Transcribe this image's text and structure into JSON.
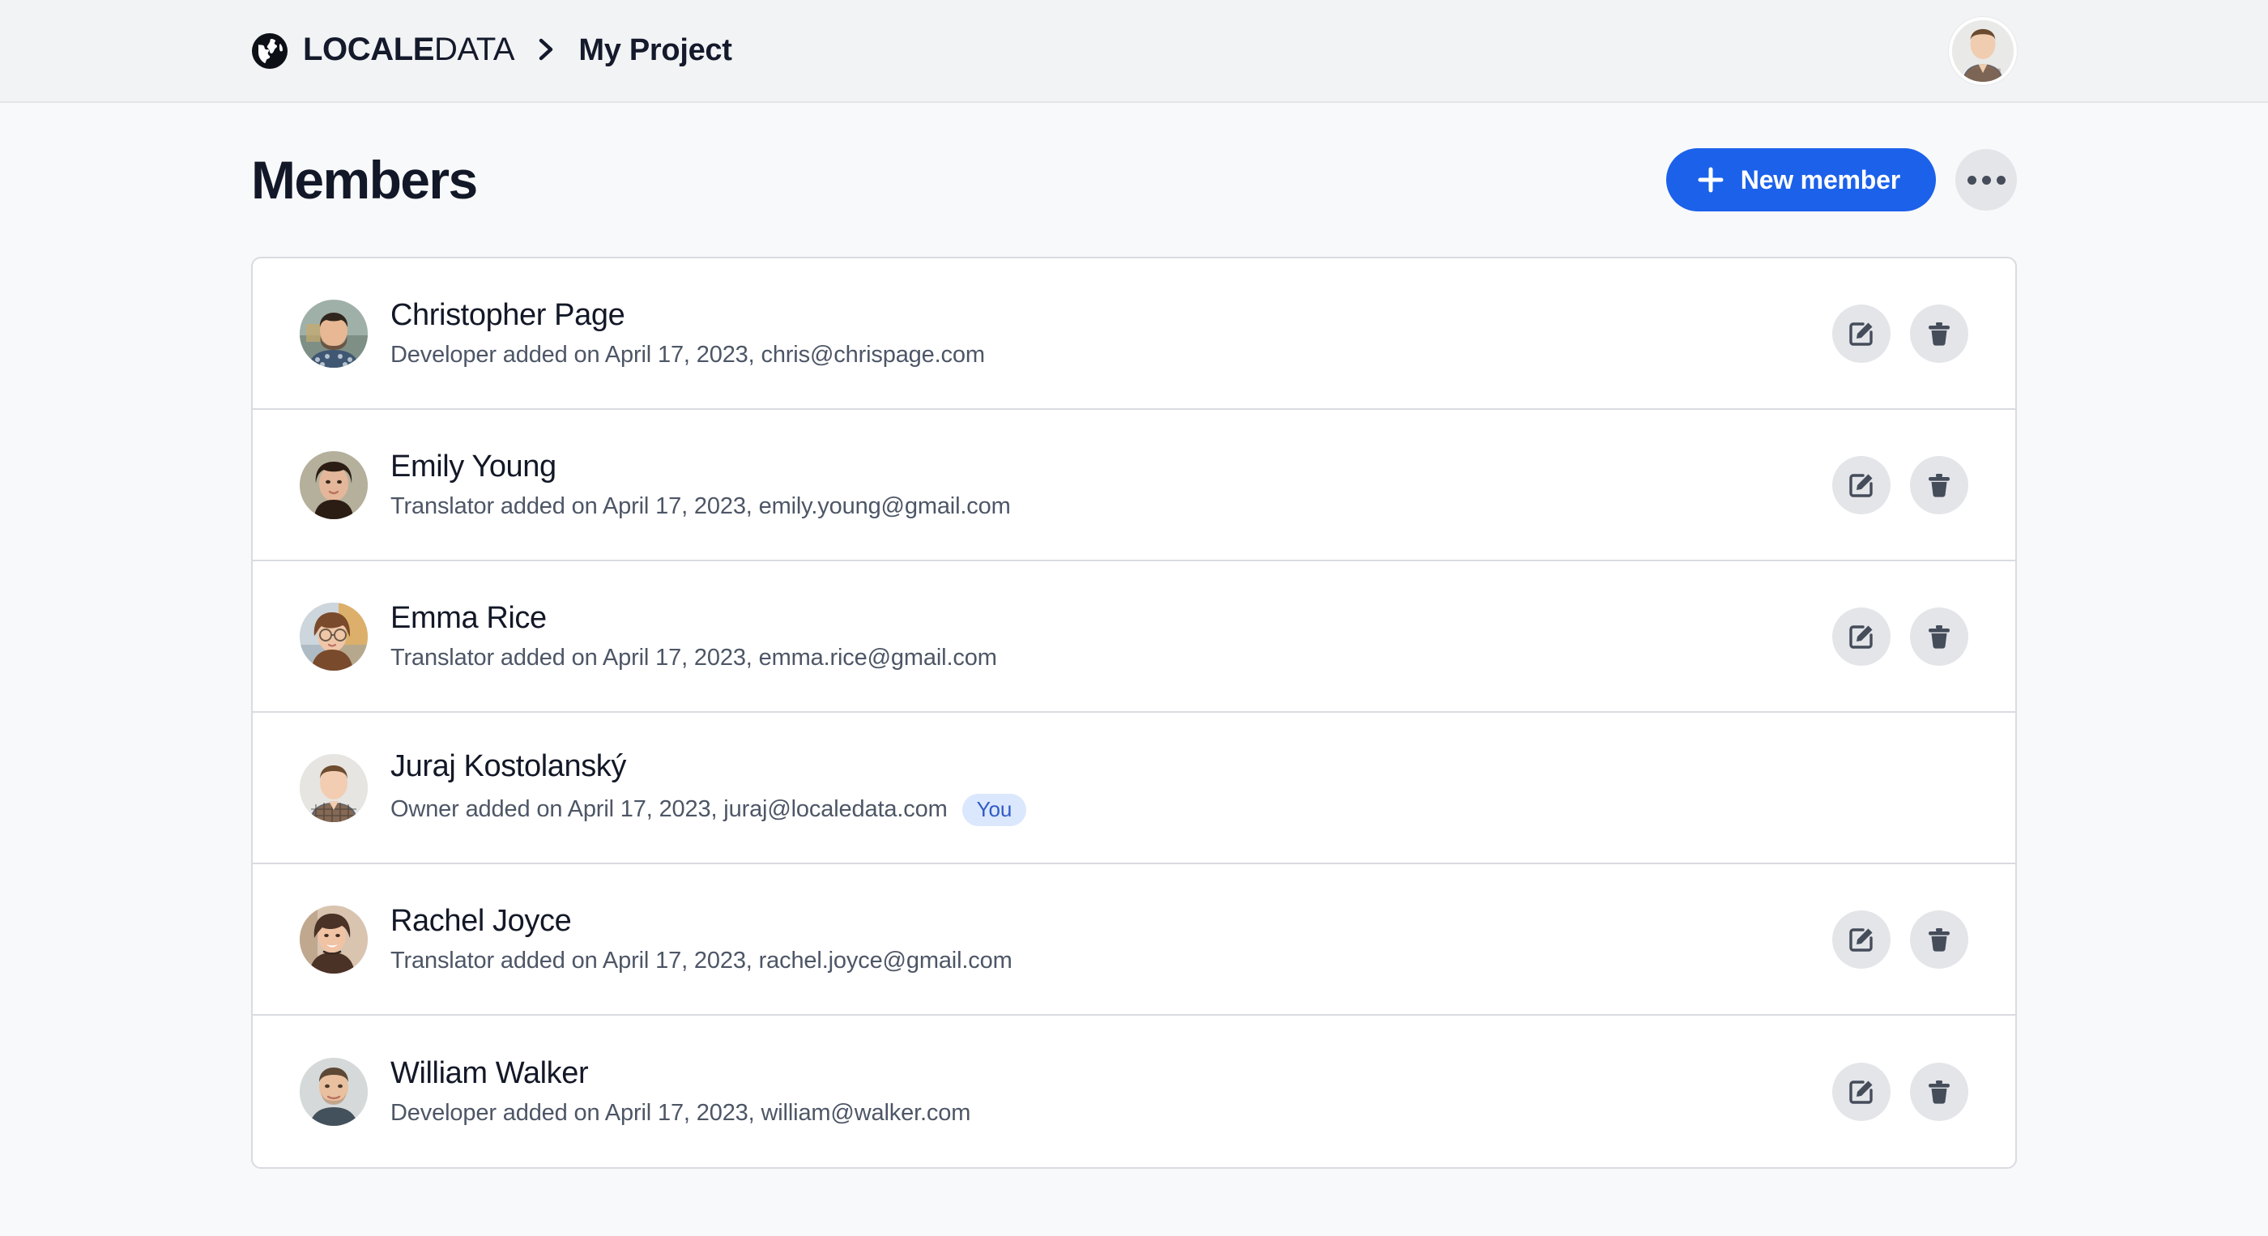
{
  "header": {
    "logo_icon": "globe-icon",
    "brand_strong": "LOCALE",
    "brand_light": "DATA",
    "breadcrumb_separator": "chevron-right-icon",
    "breadcrumb_current": "My Project",
    "avatar_alt": "user-avatar"
  },
  "page": {
    "title": "Members",
    "new_member_label": "New member",
    "new_member_icon": "plus-icon",
    "more_options_icon": "ellipsis-icon",
    "accent_color": "#1b61ea",
    "badge_bg": "#dbe7fd",
    "badge_color": "#2f5bc4"
  },
  "actions": {
    "edit_icon": "edit-icon",
    "delete_icon": "trash-icon"
  },
  "members": [
    {
      "name": "Christopher Page",
      "meta": "Developer added on April 17, 2023, chris@chrispage.com",
      "role": "Developer",
      "date": "April 17, 2023",
      "email": "chris@chrispage.com",
      "badge": "",
      "has_actions": true
    },
    {
      "name": "Emily Young",
      "meta": "Translator added on April 17, 2023, emily.young@gmail.com",
      "role": "Translator",
      "date": "April 17, 2023",
      "email": "emily.young@gmail.com",
      "badge": "",
      "has_actions": true
    },
    {
      "name": "Emma Rice",
      "meta": "Translator added on April 17, 2023, emma.rice@gmail.com",
      "role": "Translator",
      "date": "April 17, 2023",
      "email": "emma.rice@gmail.com",
      "badge": "",
      "has_actions": true
    },
    {
      "name": "Juraj Kostolanský",
      "meta": "Owner added on April 17, 2023, juraj@localedata.com",
      "role": "Owner",
      "date": "April 17, 2023",
      "email": "juraj@localedata.com",
      "badge": "You",
      "has_actions": false
    },
    {
      "name": "Rachel Joyce",
      "meta": "Translator added on April 17, 2023, rachel.joyce@gmail.com",
      "role": "Translator",
      "date": "April 17, 2023",
      "email": "rachel.joyce@gmail.com",
      "badge": "",
      "has_actions": true
    },
    {
      "name": "William Walker",
      "meta": "Developer added on April 17, 2023, william@walker.com",
      "role": "Developer",
      "date": "April 17, 2023",
      "email": "william@walker.com",
      "badge": "",
      "has_actions": true
    }
  ]
}
